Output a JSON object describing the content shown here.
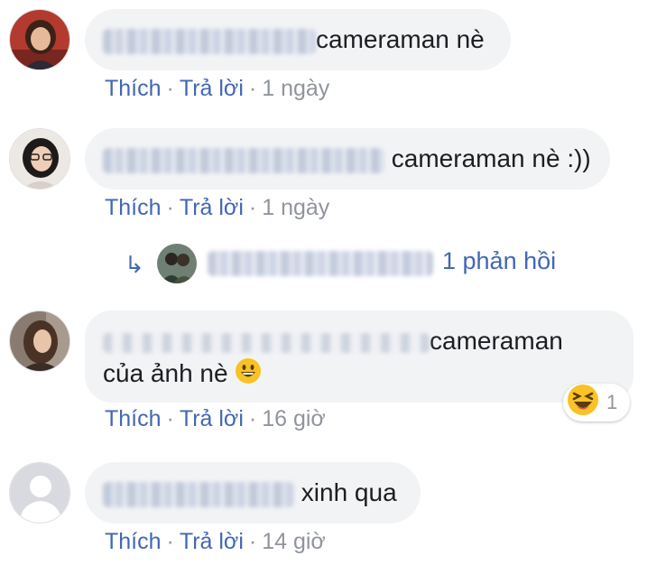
{
  "comments": [
    {
      "text": "cameraman nè",
      "actions": {
        "like": "Thích",
        "reply": "Trả lời",
        "sep": "·",
        "time": "1 ngày"
      }
    },
    {
      "text": "cameraman nè :))",
      "actions": {
        "like": "Thích",
        "reply": "Trả lời",
        "sep": "·",
        "time": "1 ngày"
      },
      "replies": {
        "count_label": "1 phản hồi"
      }
    },
    {
      "text_line1": "cameraman",
      "text_line2": "của ảnh nè",
      "emoji": "grinning-face-emoji",
      "actions": {
        "like": "Thích",
        "reply": "Trả lời",
        "sep": "·",
        "time": "16 giờ"
      },
      "reaction": {
        "type": "laughing-emoji",
        "count": "1"
      }
    },
    {
      "text": "xinh qua",
      "actions": {
        "like": "Thích",
        "reply": "Trả lời",
        "sep": "·",
        "time": "14 giờ"
      }
    }
  ],
  "colors": {
    "link": "#4267b2",
    "bubble": "#f2f3f5",
    "meta": "#90949c",
    "text": "#1c1e21"
  }
}
